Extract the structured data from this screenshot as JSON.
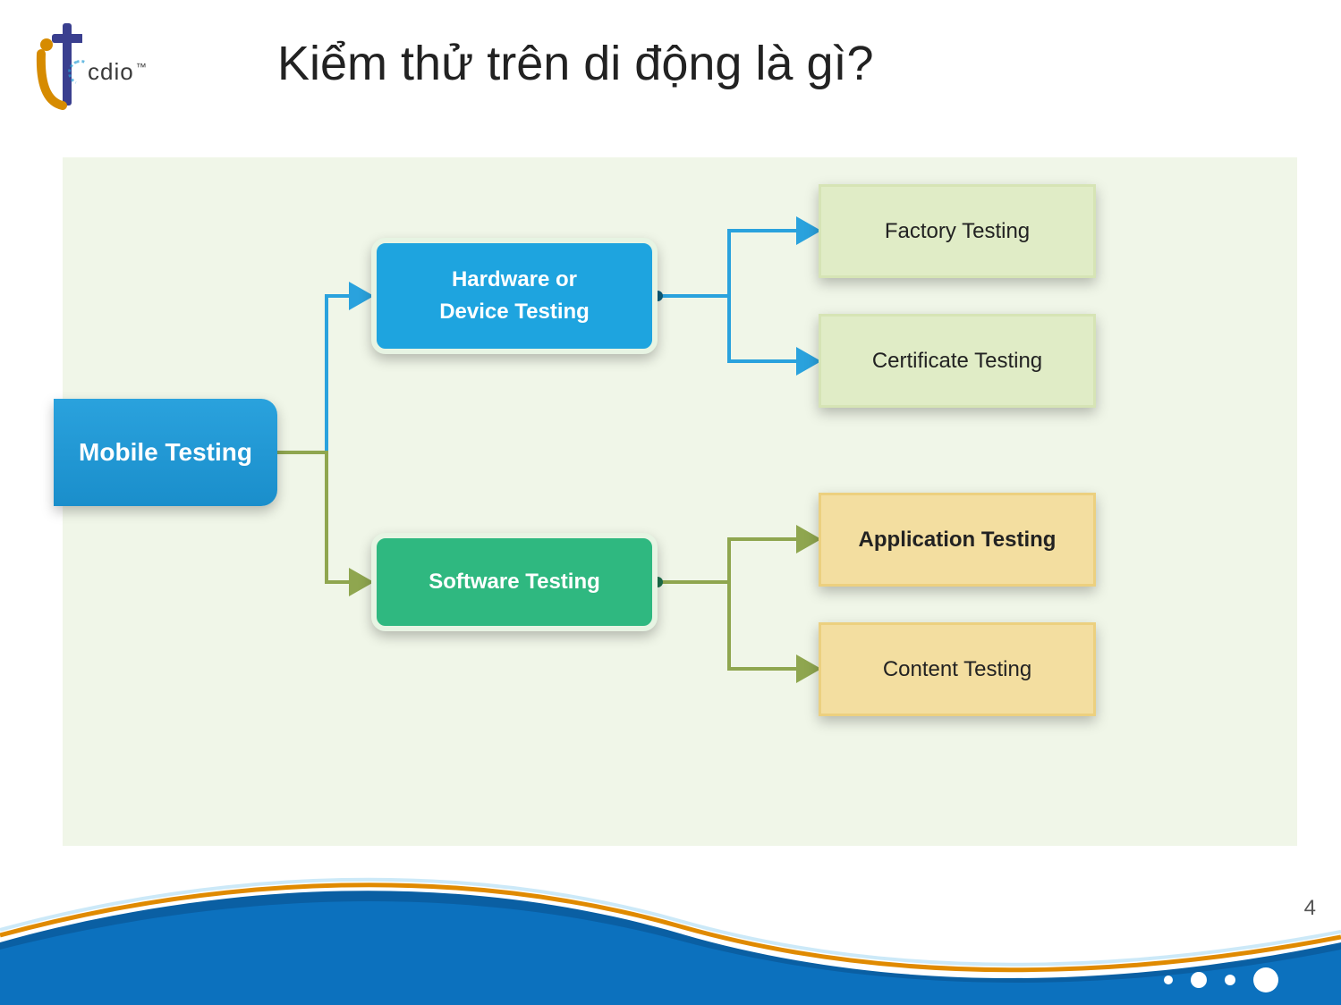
{
  "header": {
    "logo_text": "cdio"
  },
  "title": "Kiểm thử trên di động là gì?",
  "page_number": "4",
  "chart_data": {
    "type": "tree",
    "root": {
      "label": "Mobile Testing",
      "color": "#1a8ecb",
      "children": [
        {
          "label_line1": "Hardware or",
          "label_line2": "Device Testing",
          "color": "#1ea4df",
          "connector_color": "#2aa2dd",
          "children": [
            {
              "label": "Factory Testing",
              "color": "#e0ecc6"
            },
            {
              "label": "Certificate Testing",
              "color": "#e0ecc6"
            }
          ]
        },
        {
          "label": "Software Testing",
          "color": "#2fb880",
          "connector_color": "#8fa64f",
          "children": [
            {
              "label": "Application Testing",
              "color": "#f3dea0",
              "bold": true
            },
            {
              "label": "Content Testing",
              "color": "#f3dea0"
            }
          ]
        }
      ]
    }
  }
}
